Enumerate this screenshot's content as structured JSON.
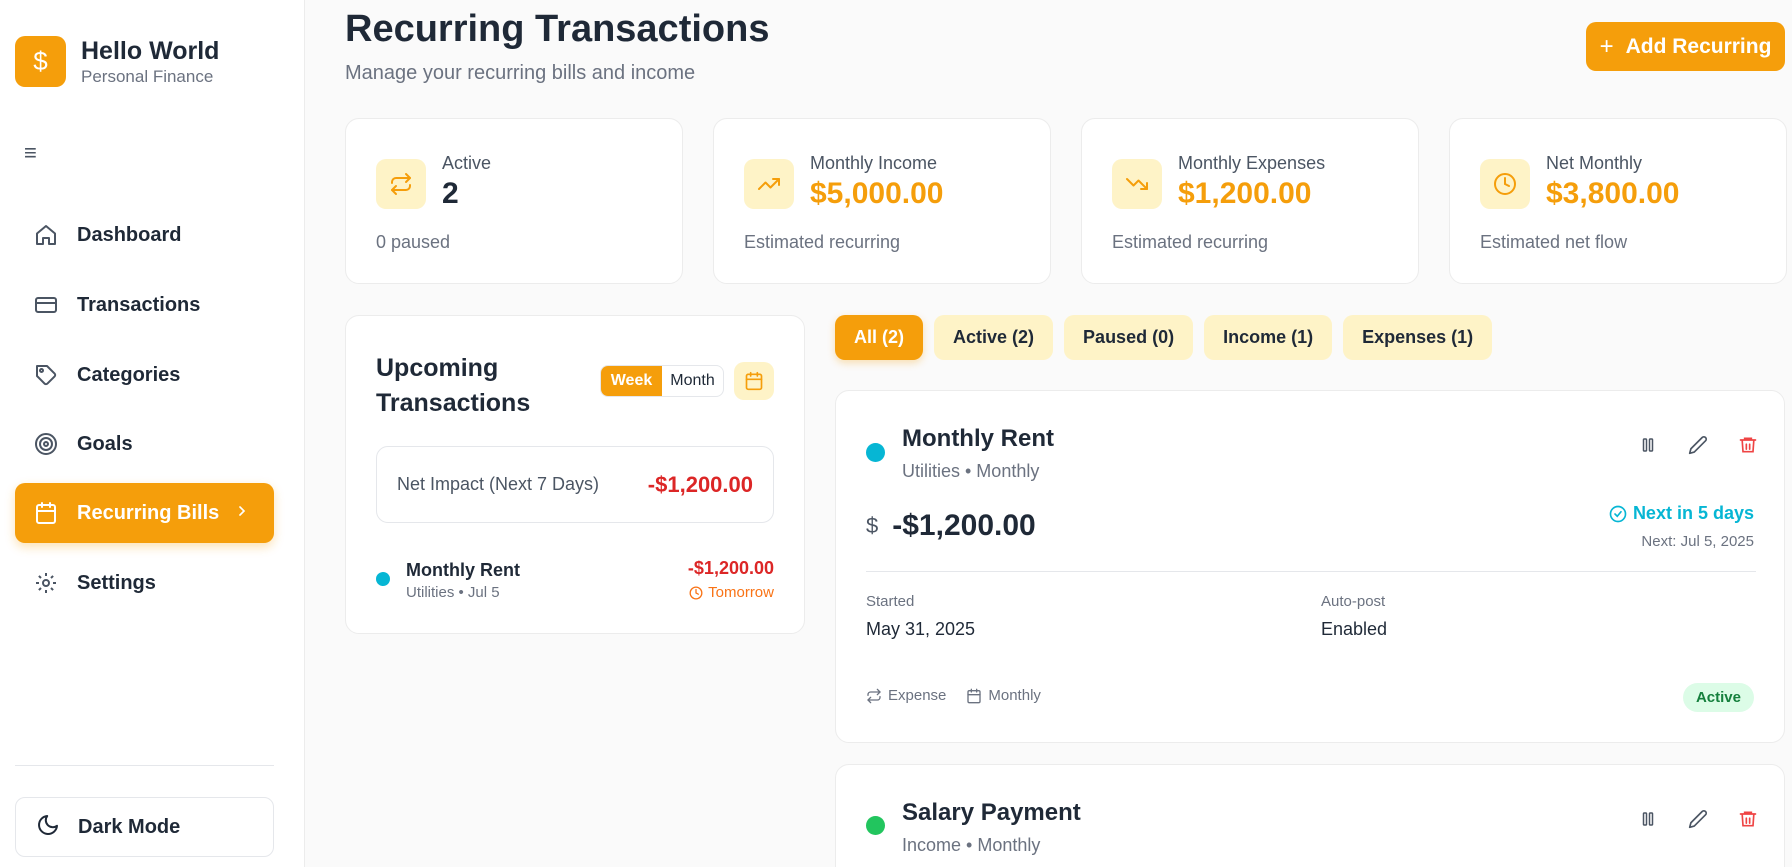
{
  "brand": {
    "logo_glyph": "$",
    "title": "Hello World",
    "subtitle": "Personal Finance"
  },
  "sidebar": {
    "menu_glyph": "≡",
    "items": [
      {
        "label": "Dashboard",
        "icon": "home-icon"
      },
      {
        "label": "Transactions",
        "icon": "card-icon"
      },
      {
        "label": "Categories",
        "icon": "tag-icon"
      },
      {
        "label": "Goals",
        "icon": "target-icon"
      },
      {
        "label": "Recurring Bills",
        "icon": "calendar-icon",
        "active": true
      },
      {
        "label": "Settings",
        "icon": "gear-icon"
      }
    ],
    "dark_mode_label": "Dark Mode"
  },
  "header": {
    "title": "Recurring Transactions",
    "subtitle": "Manage your recurring bills and income",
    "add_label": "Add Recurring",
    "add_glyph": "+"
  },
  "stats": [
    {
      "label": "Active",
      "value": "2",
      "foot": "0 paused",
      "icon": "repeat-icon"
    },
    {
      "label": "Monthly Income",
      "value": "$5,000.00",
      "foot": "Estimated recurring",
      "icon": "trending-up-icon"
    },
    {
      "label": "Monthly Expenses",
      "value": "$1,200.00",
      "foot": "Estimated recurring",
      "icon": "trending-down-icon"
    },
    {
      "label": "Net Monthly",
      "value": "$3,800.00",
      "foot": "Estimated net flow",
      "icon": "clock-icon"
    }
  ],
  "upcoming": {
    "title": "Upcoming Transactions",
    "toggle": [
      "Week",
      "Month"
    ],
    "net_label": "Net Impact (Next 7 Days)",
    "net_value": "-$1,200.00",
    "items": [
      {
        "name": "Monthly Rent",
        "meta": "Utilities • Jul 5",
        "amount": "-$1,200.00",
        "when": "Tomorrow",
        "color": "#06b6d4"
      }
    ]
  },
  "filters": [
    "All (2)",
    "Active (2)",
    "Paused (0)",
    "Income (1)",
    "Expenses (1)"
  ],
  "recurring": [
    {
      "name": "Monthly Rent",
      "meta": "Utilities • Monthly",
      "color": "#06b6d4",
      "currency": "$",
      "amount": "-$1,200.00",
      "next": "Next in 5 days",
      "next_date": "Next: Jul 5, 2025",
      "started_label": "Started",
      "started_value": "May 31, 2025",
      "autopost_label": "Auto-post",
      "autopost_value": "Enabled",
      "type_tag": "Expense",
      "freq_tag": "Monthly",
      "status": "Active"
    },
    {
      "name": "Salary Payment",
      "meta": "Income • Monthly",
      "color": "#22c55e"
    }
  ],
  "colors": {
    "accent": "#f59e0b",
    "accent_soft": "#fef3c7",
    "negative": "#dc2626",
    "info": "#06b6d4",
    "success": "#22c55e"
  }
}
